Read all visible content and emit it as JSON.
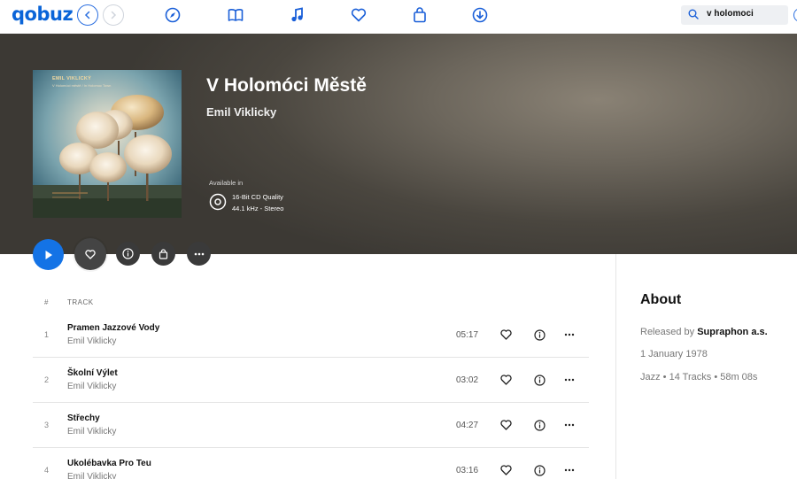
{
  "app": {
    "logo": "qobuz"
  },
  "nav": {
    "icons": [
      "discover-icon",
      "library-icon",
      "music-icon",
      "favorites-icon",
      "shop-bag-icon",
      "download-icon"
    ]
  },
  "search": {
    "value": "v holomoci"
  },
  "album": {
    "title": "V Holomóci Městě",
    "artist": "Emil Viklicky",
    "cover_title": "EMIL VIKLICKÝ",
    "cover_subtitle": "V Holomóci městě / In Holomuc Town",
    "available_label": "Available in",
    "quality_line1": "16-Bit CD Quality",
    "quality_line2": "44.1 kHz - Stereo"
  },
  "colors": {
    "accent": "#1473e6",
    "logo": "#0a64d8"
  },
  "tracklist": {
    "header_num": "#",
    "header_track": "TRACK",
    "tracks": [
      {
        "num": "1",
        "title": "Pramen Jazzové Vody",
        "artist": "Emil Viklicky",
        "duration": "05:17"
      },
      {
        "num": "2",
        "title": "Školní Výlet",
        "artist": "Emil Viklicky",
        "duration": "03:02"
      },
      {
        "num": "3",
        "title": "Střechy",
        "artist": "Emil Viklicky",
        "duration": "04:27"
      },
      {
        "num": "4",
        "title": "Ukolébavka Pro Teu",
        "artist": "Emil Viklicky",
        "duration": "03:16"
      }
    ]
  },
  "about": {
    "heading": "About",
    "released_prefix": "Released by",
    "label": "Supraphon a.s.",
    "date": "1 January 1978",
    "meta": "Jazz • 14 Tracks • 58m 08s"
  }
}
